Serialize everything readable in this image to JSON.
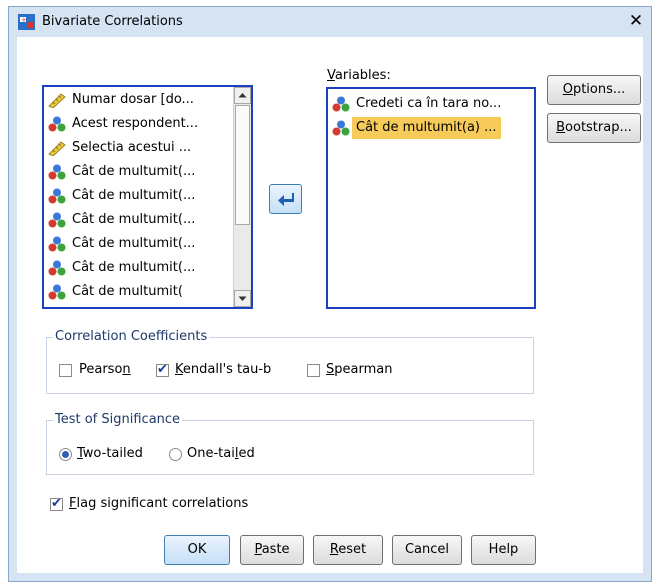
{
  "window": {
    "title": "Bivariate Correlations",
    "close_glyph": "✕"
  },
  "source_list": {
    "items": [
      {
        "label": "Numar dosar [do...",
        "icon": "scale-ruler-icon"
      },
      {
        "label": "Acest respondent...",
        "icon": "nominal-variable-icon"
      },
      {
        "label": "Selectia acestui ...",
        "icon": "scale-ruler-icon"
      },
      {
        "label": "Cât de multumit(...",
        "icon": "nominal-variable-icon"
      },
      {
        "label": "Cât de multumit(...",
        "icon": "nominal-variable-icon"
      },
      {
        "label": "Cât de multumit(...",
        "icon": "nominal-variable-icon"
      },
      {
        "label": "Cât de multumit(...",
        "icon": "nominal-variable-icon"
      },
      {
        "label": "Cât de multumit(...",
        "icon": "nominal-variable-icon"
      },
      {
        "label": "Cât de multumit(",
        "icon": "nominal-variable-icon"
      }
    ]
  },
  "move_button": {
    "icon": "arrow-left-icon"
  },
  "variables": {
    "label": "Variables:",
    "items": [
      {
        "label": "Credeti ca în tara no...",
        "selected": false
      },
      {
        "label": "Cât de multumit(a) ...",
        "selected": true
      }
    ]
  },
  "side_buttons": {
    "options": "Options...",
    "bootstrap": "Bootstrap..."
  },
  "coefficients": {
    "legend": "Correlation Coefficients",
    "pearson": {
      "label": "Pearson",
      "checked": false
    },
    "kendall": {
      "label": "Kendall's tau-b",
      "checked": true
    },
    "spearman": {
      "label": "Spearman",
      "checked": false
    }
  },
  "significance": {
    "legend": "Test of Significance",
    "two_tailed": {
      "label": "Two-tailed",
      "selected": true
    },
    "one_tailed": {
      "label": "One-tailed",
      "selected": false
    }
  },
  "flag": {
    "label": "Flag significant correlations",
    "checked": true
  },
  "footer": {
    "ok": "OK",
    "paste": "Paste",
    "reset": "Reset",
    "cancel": "Cancel",
    "help": "Help"
  },
  "colors": {
    "accent": "#1a3fc0",
    "selection": "#f7cb5a",
    "window_bg": "#d6e3f2"
  }
}
